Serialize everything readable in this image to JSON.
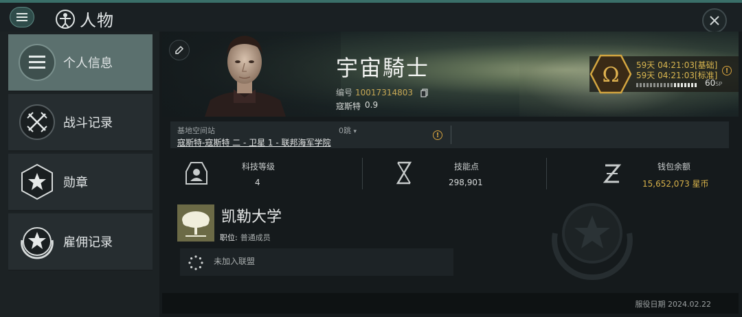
{
  "header": {
    "title": "人物"
  },
  "sidebar": {
    "items": [
      {
        "label": "个人信息",
        "icon": "profile-list-icon",
        "active": true
      },
      {
        "label": "战斗记录",
        "icon": "crossed-swords-icon",
        "active": false
      },
      {
        "label": "勋章",
        "icon": "medal-star-icon",
        "active": false
      },
      {
        "label": "雇佣记录",
        "icon": "laurel-star-icon",
        "active": false
      }
    ]
  },
  "character": {
    "name": "宇宙騎士",
    "id_label": "编号",
    "id_value": "10017314803",
    "security_label": "寇斯特",
    "security_value": "0.9"
  },
  "omega": {
    "line1": "59天 04:21:03[基础]",
    "line2": "59天 04:21:03[标准]",
    "sp_value": "60",
    "sp_unit": "SP",
    "accent": "#d9b64f"
  },
  "station": {
    "label": "基地空间站",
    "jumps": "0跳",
    "path": "寇斯特-寇斯特 二 - 卫星 1 - 联邦海军学院"
  },
  "stats": {
    "tech_label": "科技等级",
    "tech_value": "4",
    "skill_label": "技能点",
    "skill_value": "298,901",
    "wallet_label": "钱包余额",
    "wallet_value": "15,652,073 星币"
  },
  "corporation": {
    "name": "凯勒大学",
    "role_key": "职位:",
    "role_value": "普通成员",
    "alliance": "未加入联盟"
  },
  "footer": {
    "service_date": "服役日期 2024.02.22"
  }
}
